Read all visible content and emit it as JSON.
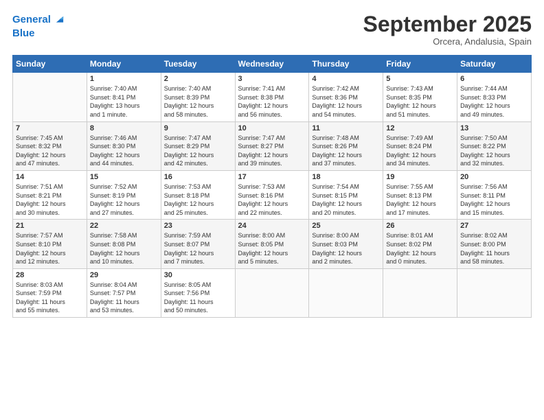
{
  "logo": {
    "line1": "General",
    "line2": "Blue"
  },
  "title": "September 2025",
  "location": "Orcera, Andalusia, Spain",
  "header_days": [
    "Sunday",
    "Monday",
    "Tuesday",
    "Wednesday",
    "Thursday",
    "Friday",
    "Saturday"
  ],
  "weeks": [
    [
      {
        "num": "",
        "info": ""
      },
      {
        "num": "1",
        "info": "Sunrise: 7:40 AM\nSunset: 8:41 PM\nDaylight: 13 hours\nand 1 minute."
      },
      {
        "num": "2",
        "info": "Sunrise: 7:40 AM\nSunset: 8:39 PM\nDaylight: 12 hours\nand 58 minutes."
      },
      {
        "num": "3",
        "info": "Sunrise: 7:41 AM\nSunset: 8:38 PM\nDaylight: 12 hours\nand 56 minutes."
      },
      {
        "num": "4",
        "info": "Sunrise: 7:42 AM\nSunset: 8:36 PM\nDaylight: 12 hours\nand 54 minutes."
      },
      {
        "num": "5",
        "info": "Sunrise: 7:43 AM\nSunset: 8:35 PM\nDaylight: 12 hours\nand 51 minutes."
      },
      {
        "num": "6",
        "info": "Sunrise: 7:44 AM\nSunset: 8:33 PM\nDaylight: 12 hours\nand 49 minutes."
      }
    ],
    [
      {
        "num": "7",
        "info": "Sunrise: 7:45 AM\nSunset: 8:32 PM\nDaylight: 12 hours\nand 47 minutes."
      },
      {
        "num": "8",
        "info": "Sunrise: 7:46 AM\nSunset: 8:30 PM\nDaylight: 12 hours\nand 44 minutes."
      },
      {
        "num": "9",
        "info": "Sunrise: 7:47 AM\nSunset: 8:29 PM\nDaylight: 12 hours\nand 42 minutes."
      },
      {
        "num": "10",
        "info": "Sunrise: 7:47 AM\nSunset: 8:27 PM\nDaylight: 12 hours\nand 39 minutes."
      },
      {
        "num": "11",
        "info": "Sunrise: 7:48 AM\nSunset: 8:26 PM\nDaylight: 12 hours\nand 37 minutes."
      },
      {
        "num": "12",
        "info": "Sunrise: 7:49 AM\nSunset: 8:24 PM\nDaylight: 12 hours\nand 34 minutes."
      },
      {
        "num": "13",
        "info": "Sunrise: 7:50 AM\nSunset: 8:22 PM\nDaylight: 12 hours\nand 32 minutes."
      }
    ],
    [
      {
        "num": "14",
        "info": "Sunrise: 7:51 AM\nSunset: 8:21 PM\nDaylight: 12 hours\nand 30 minutes."
      },
      {
        "num": "15",
        "info": "Sunrise: 7:52 AM\nSunset: 8:19 PM\nDaylight: 12 hours\nand 27 minutes."
      },
      {
        "num": "16",
        "info": "Sunrise: 7:53 AM\nSunset: 8:18 PM\nDaylight: 12 hours\nand 25 minutes."
      },
      {
        "num": "17",
        "info": "Sunrise: 7:53 AM\nSunset: 8:16 PM\nDaylight: 12 hours\nand 22 minutes."
      },
      {
        "num": "18",
        "info": "Sunrise: 7:54 AM\nSunset: 8:15 PM\nDaylight: 12 hours\nand 20 minutes."
      },
      {
        "num": "19",
        "info": "Sunrise: 7:55 AM\nSunset: 8:13 PM\nDaylight: 12 hours\nand 17 minutes."
      },
      {
        "num": "20",
        "info": "Sunrise: 7:56 AM\nSunset: 8:11 PM\nDaylight: 12 hours\nand 15 minutes."
      }
    ],
    [
      {
        "num": "21",
        "info": "Sunrise: 7:57 AM\nSunset: 8:10 PM\nDaylight: 12 hours\nand 12 minutes."
      },
      {
        "num": "22",
        "info": "Sunrise: 7:58 AM\nSunset: 8:08 PM\nDaylight: 12 hours\nand 10 minutes."
      },
      {
        "num": "23",
        "info": "Sunrise: 7:59 AM\nSunset: 8:07 PM\nDaylight: 12 hours\nand 7 minutes."
      },
      {
        "num": "24",
        "info": "Sunrise: 8:00 AM\nSunset: 8:05 PM\nDaylight: 12 hours\nand 5 minutes."
      },
      {
        "num": "25",
        "info": "Sunrise: 8:00 AM\nSunset: 8:03 PM\nDaylight: 12 hours\nand 2 minutes."
      },
      {
        "num": "26",
        "info": "Sunrise: 8:01 AM\nSunset: 8:02 PM\nDaylight: 12 hours\nand 0 minutes."
      },
      {
        "num": "27",
        "info": "Sunrise: 8:02 AM\nSunset: 8:00 PM\nDaylight: 11 hours\nand 58 minutes."
      }
    ],
    [
      {
        "num": "28",
        "info": "Sunrise: 8:03 AM\nSunset: 7:59 PM\nDaylight: 11 hours\nand 55 minutes."
      },
      {
        "num": "29",
        "info": "Sunrise: 8:04 AM\nSunset: 7:57 PM\nDaylight: 11 hours\nand 53 minutes."
      },
      {
        "num": "30",
        "info": "Sunrise: 8:05 AM\nSunset: 7:56 PM\nDaylight: 11 hours\nand 50 minutes."
      },
      {
        "num": "",
        "info": ""
      },
      {
        "num": "",
        "info": ""
      },
      {
        "num": "",
        "info": ""
      },
      {
        "num": "",
        "info": ""
      }
    ]
  ]
}
